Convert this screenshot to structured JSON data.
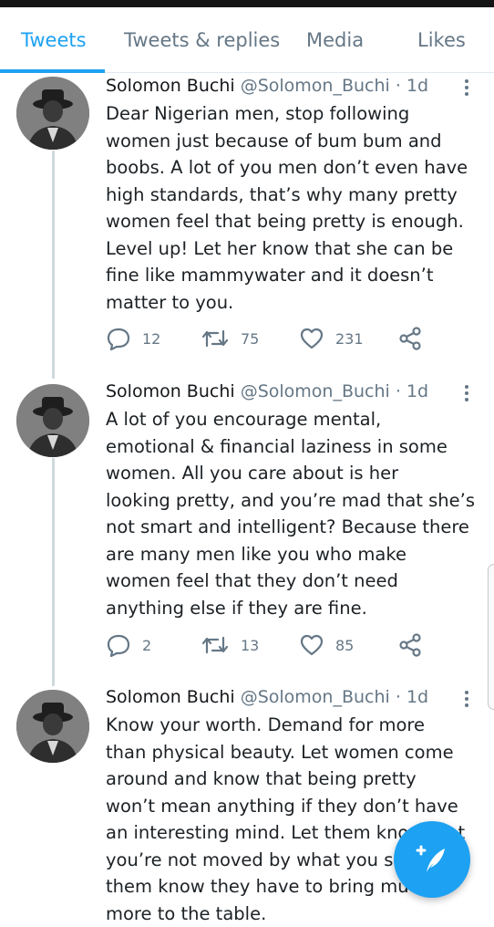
{
  "tabs": [
    "Tweets",
    "Tweets & replies",
    "Media",
    "Likes"
  ],
  "active_tab": "Tweets",
  "colors": {
    "accent": "#1da1f2",
    "muted": "#657786",
    "text": "#1c2125"
  },
  "tweets": [
    {
      "name": "Solomon Buchi",
      "handle": "@Solomon_Buchi",
      "time": "· 1d",
      "lines": [
        "Dear Nigerian men, stop following",
        "women just because of bum bum and",
        "boobs. A lot of you men don’t even have",
        "high standards, that’s why many pretty",
        "women feel that being pretty is enough.",
        "Level up! Let her know that she can be",
        "fine like mammywater and it doesn’t",
        "matter to you."
      ],
      "replies": "12",
      "retweets": "75",
      "likes": "231"
    },
    {
      "name": "Solomon Buchi",
      "handle": "@Solomon_Buchi",
      "time": "· 1d",
      "lines": [
        "A lot of you encourage mental,",
        "emotional & financial laziness in some",
        "women. All you care about is her",
        "looking pretty, and you’re mad that she’s",
        "not smart and intelligent? Because there",
        "are many men like you who make",
        "women feel that they don’t need",
        "anything else if they are fine."
      ],
      "replies": "2",
      "retweets": "13",
      "likes": "85"
    },
    {
      "name": "Solomon Buchi",
      "handle": "@Solomon_Buchi",
      "time": "· 1d",
      "lines": [
        "Know your worth. Demand for more",
        "than physical beauty. Let women come",
        "around and know that being pretty",
        "won’t mean anything if they don’t have",
        "an interesting mind. Let them know that",
        "you’re not moved by what you see. Let",
        "them know they have to bring much",
        "more to the table."
      ]
    }
  ],
  "icons": [
    "reply-icon",
    "retweet-icon",
    "like-icon",
    "share-icon",
    "more-icon",
    "compose-icon"
  ]
}
